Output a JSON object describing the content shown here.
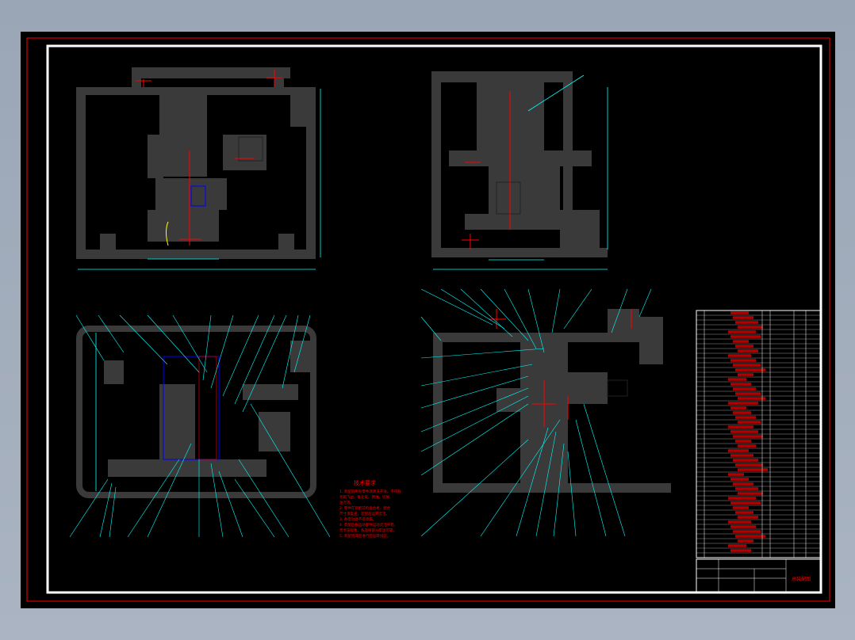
{
  "app": {
    "title": ""
  },
  "drawing": {
    "title": "",
    "technical_requirements_title": "技术要求",
    "technical_requirements": [
      "1. 装配前所有零件须清洗干净，不得有",
      "毛刺飞边、氧化皮、锈蚀、切屑、",
      "油污等。",
      "2. 零件在装配前检查合格，配合",
      "尺寸须复查，装配后运转灵活。",
      "3. 各密封处不得渗漏。",
      "4. 装配后各运动部件运动灵活平稳，",
      "无卡滞现象，各连接部分牢固可靠。",
      "5. 装配完成后进行空运转试验。"
    ],
    "title_block_name": "总装配图",
    "colors": {
      "background": "#000000",
      "part": "#3c3c3c",
      "frame": "#ffffff",
      "border": "#ff0000",
      "centerline": "#ff0000",
      "dimension": "#00ffff",
      "hidden": "#0000ff",
      "text": "#ff0000"
    }
  }
}
